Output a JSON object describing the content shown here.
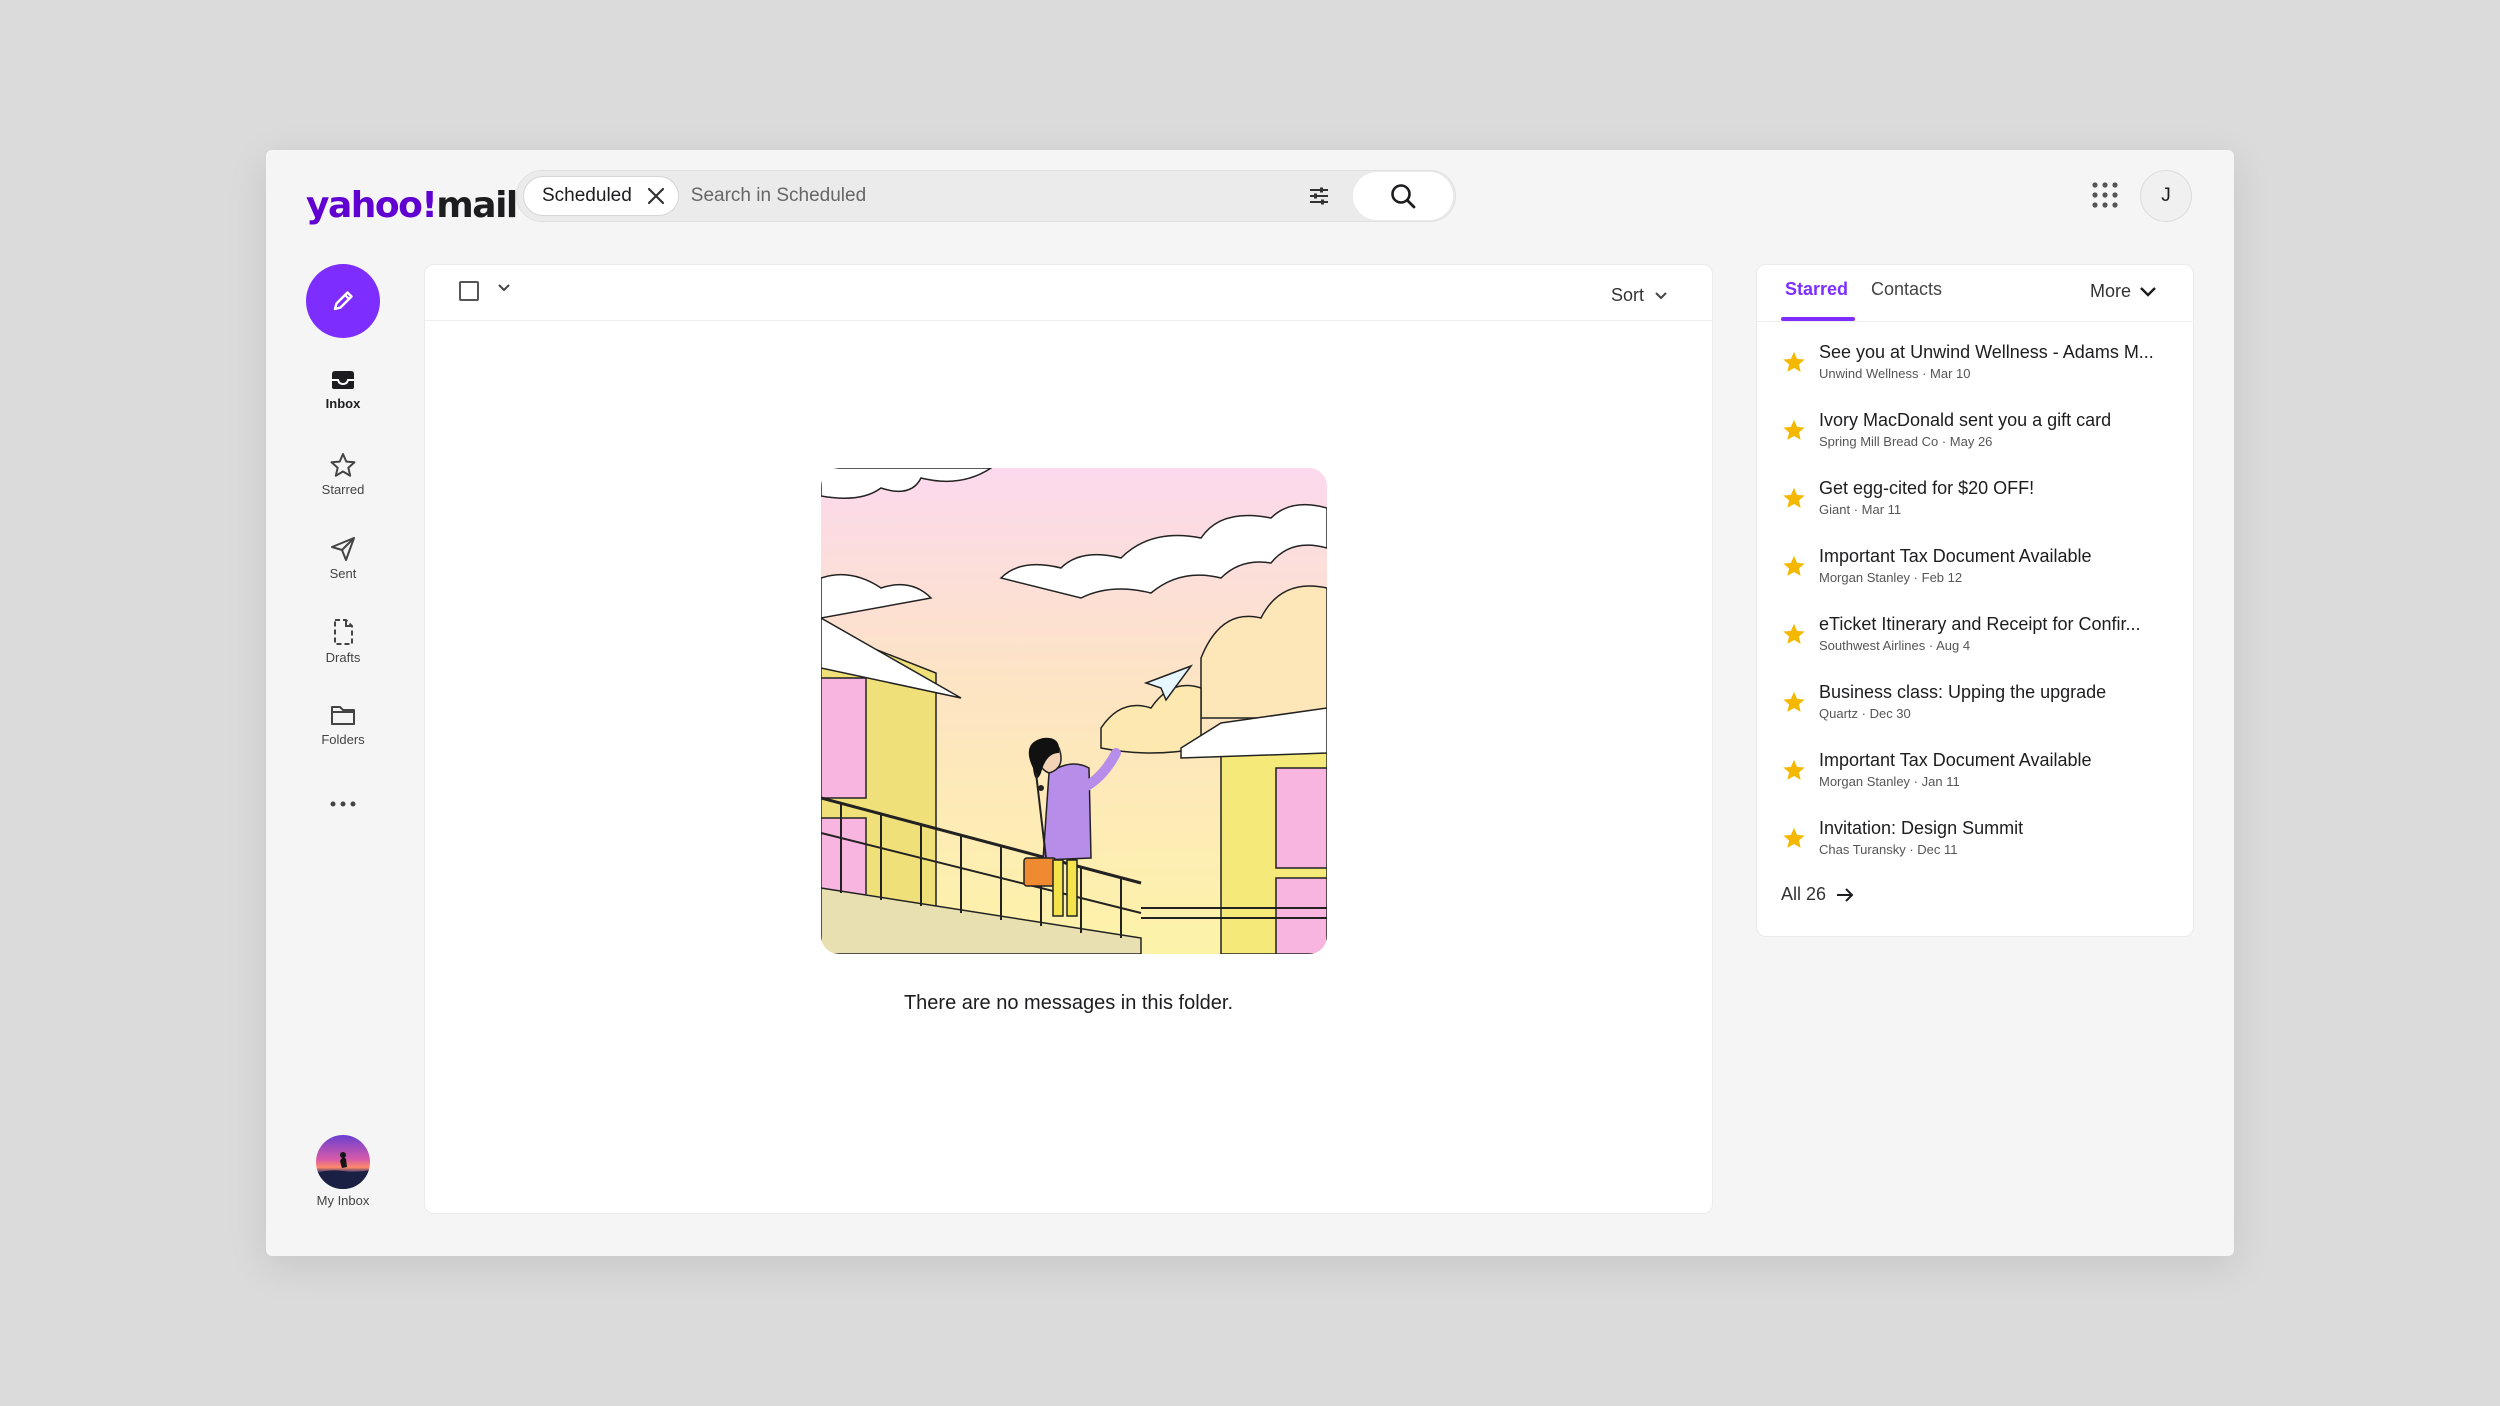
{
  "brand": {
    "logo_main": "yahoo!",
    "logo_sub": "mail"
  },
  "search": {
    "chip_label": "Scheduled",
    "placeholder": "Search in Scheduled"
  },
  "header": {
    "avatar_initial": "J"
  },
  "nav": {
    "items": [
      {
        "label": "Inbox",
        "icon": "inbox-icon"
      },
      {
        "label": "Starred",
        "icon": "star-icon"
      },
      {
        "label": "Sent",
        "icon": "send-icon"
      },
      {
        "label": "Drafts",
        "icon": "draft-icon"
      },
      {
        "label": "Folders",
        "icon": "folder-icon"
      }
    ],
    "my_inbox_label": "My Inbox"
  },
  "main": {
    "sort_label": "Sort",
    "empty_message": "There are no messages in this folder."
  },
  "side": {
    "tabs": [
      "Starred",
      "Contacts"
    ],
    "more_label": "More",
    "items": [
      {
        "subject": "See you at Unwind Wellness - Adams M...",
        "sender": "Unwind Wellness",
        "date": "Mar 10"
      },
      {
        "subject": "Ivory MacDonald sent you a gift card",
        "sender": "Spring Mill Bread Co",
        "date": "May 26"
      },
      {
        "subject": "Get egg-cited for $20 OFF!",
        "sender": "Giant",
        "date": "Mar 11"
      },
      {
        "subject": "Important Tax Document Available",
        "sender": "Morgan Stanley",
        "date": "Feb 12"
      },
      {
        "subject": "eTicket Itinerary and Receipt for Confir...",
        "sender": "Southwest Airlines",
        "date": "Aug 4"
      },
      {
        "subject": "Business class: Upping the upgrade",
        "sender": "Quartz",
        "date": "Dec 30"
      },
      {
        "subject": "Important Tax Document Available",
        "sender": "Morgan Stanley",
        "date": "Jan 11"
      },
      {
        "subject": "Invitation: Design Summit",
        "sender": "Chas Turansky",
        "date": "Dec 11"
      }
    ],
    "all_label": "All 26"
  },
  "colors": {
    "accent": "#7d2eff",
    "brand": "#6001d2",
    "star": "#f5b800"
  }
}
